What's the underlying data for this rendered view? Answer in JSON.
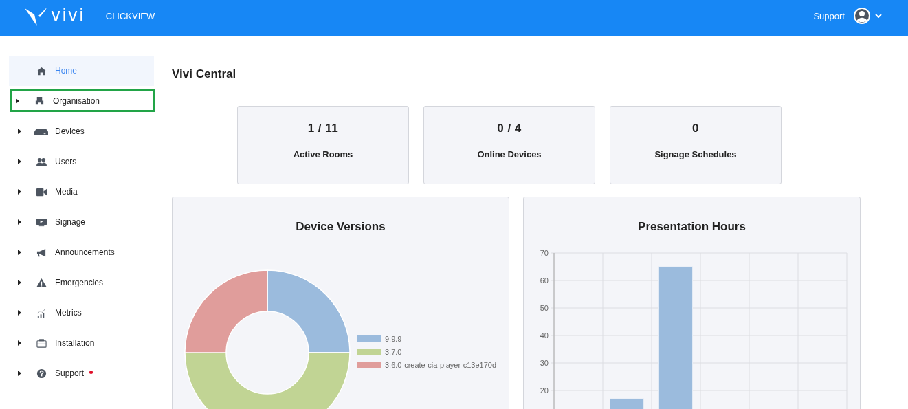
{
  "header": {
    "brand": "vivi",
    "organisation": "CLICKVIEW",
    "support_link": "Support"
  },
  "sidebar": {
    "items": [
      {
        "label": "Home",
        "selected": true,
        "expandable": false,
        "highlighted": false,
        "notification_dot": false
      },
      {
        "label": "Organisation",
        "selected": false,
        "expandable": true,
        "highlighted": true,
        "notification_dot": false
      },
      {
        "label": "Devices",
        "selected": false,
        "expandable": true,
        "highlighted": false,
        "notification_dot": false
      },
      {
        "label": "Users",
        "selected": false,
        "expandable": true,
        "highlighted": false,
        "notification_dot": false
      },
      {
        "label": "Media",
        "selected": false,
        "expandable": true,
        "highlighted": false,
        "notification_dot": false
      },
      {
        "label": "Signage",
        "selected": false,
        "expandable": true,
        "highlighted": false,
        "notification_dot": false
      },
      {
        "label": "Announcements",
        "selected": false,
        "expandable": true,
        "highlighted": false,
        "notification_dot": false
      },
      {
        "label": "Emergencies",
        "selected": false,
        "expandable": true,
        "highlighted": false,
        "notification_dot": false
      },
      {
        "label": "Metrics",
        "selected": false,
        "expandable": true,
        "highlighted": false,
        "notification_dot": false
      },
      {
        "label": "Installation",
        "selected": false,
        "expandable": true,
        "highlighted": false,
        "notification_dot": false
      },
      {
        "label": "Support",
        "selected": false,
        "expandable": true,
        "highlighted": false,
        "notification_dot": true
      }
    ]
  },
  "page_title": "Vivi Central",
  "stats": [
    {
      "value": "1 / 11",
      "label": "Active Rooms"
    },
    {
      "value": "0 / 4",
      "label": "Online Devices"
    },
    {
      "value": "0",
      "label": "Signage Schedules"
    }
  ],
  "charts": [
    {
      "title": "Device Versions",
      "chart_data": {
        "type": "donut",
        "categories": [
          "9.9.9",
          "3.7.0",
          "3.6.0-create-cia-player-c13e170d"
        ],
        "values": [
          25,
          50,
          25
        ],
        "legend": "right"
      }
    },
    {
      "title": "Presentation Hours",
      "chart_data": {
        "type": "bar",
        "grid": true,
        "series": [
          {
            "color": "#9bbbdd",
            "values": [
              0,
              17,
              65,
              0,
              0,
              0
            ]
          }
        ],
        "ylim": [
          0,
          70
        ],
        "yticks": [
          20,
          30,
          40,
          50,
          60,
          70
        ]
      }
    }
  ]
}
